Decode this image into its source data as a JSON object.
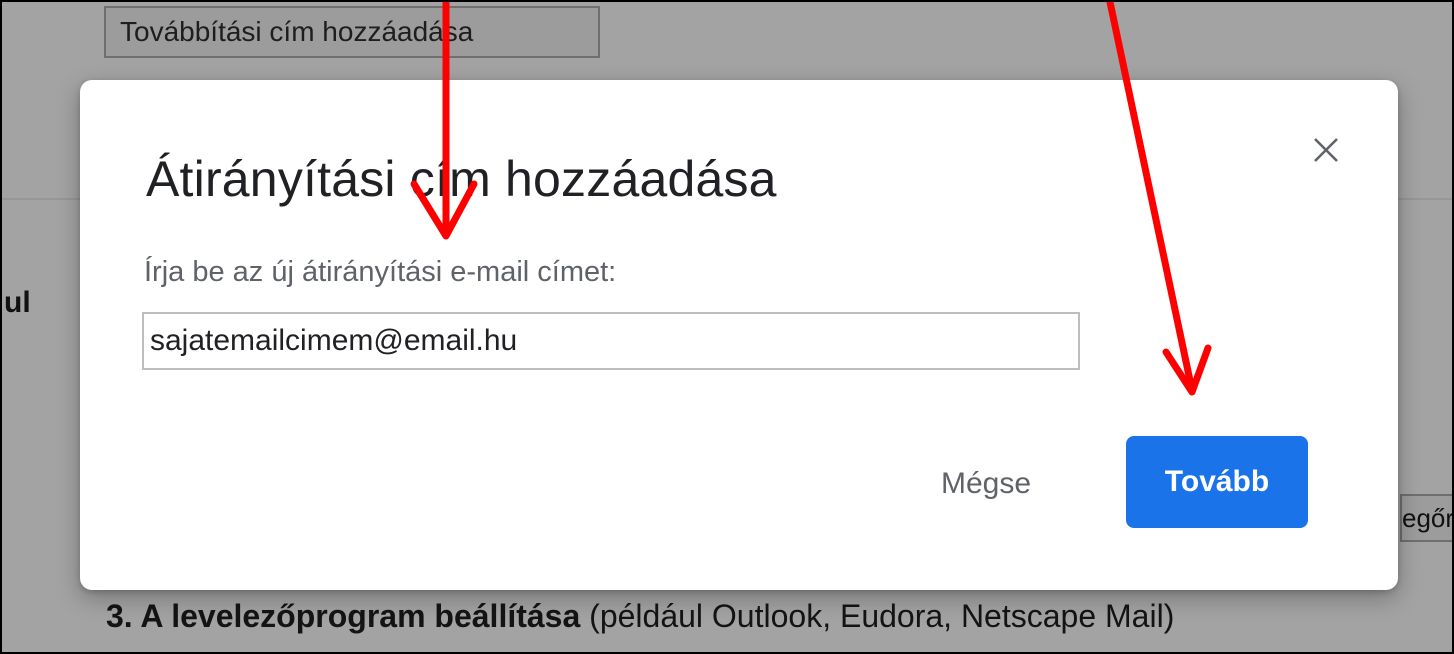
{
  "background": {
    "forward_button_label": "Továbbítási cím hozzáadása",
    "side_text": "ul",
    "right_box_text": "egőr",
    "bottom_bold": "3. A levelezőprogram beállítása",
    "bottom_rest": " (például Outlook, Eudora, Netscape Mail)"
  },
  "dialog": {
    "title": "Átirányítási cím hozzáadása",
    "prompt": "Írja be az új átirányítási e-mail címet:",
    "email_value": "sajatemailcimem@email.hu",
    "cancel_label": "Mégse",
    "next_label": "Tovább",
    "close_icon": "close-icon"
  },
  "colors": {
    "primary": "#1a73e8",
    "annotation_arrow": "#ff0000",
    "overlay": "#a3a3a3"
  }
}
